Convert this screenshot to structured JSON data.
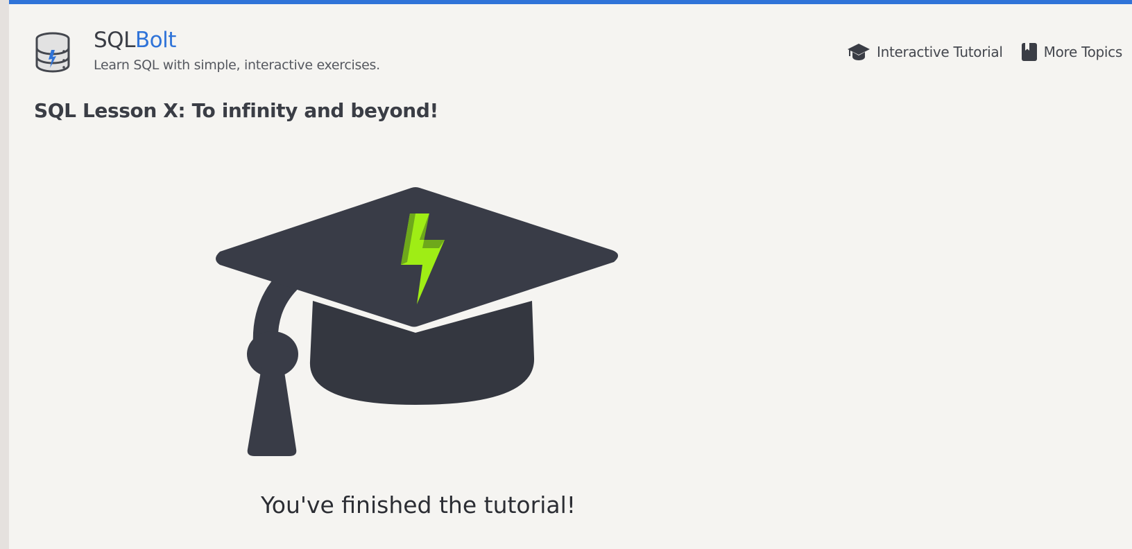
{
  "header": {
    "brand_prefix": "SQL",
    "brand_suffix": "Bolt",
    "tagline": "Learn SQL with simple, interactive exercises.",
    "logo_icon": "database-bolt-icon"
  },
  "nav": {
    "items": [
      {
        "label": "Interactive Tutorial",
        "icon": "graduation-cap-icon"
      },
      {
        "label": "More Topics",
        "icon": "book-icon"
      }
    ]
  },
  "lesson": {
    "title": "SQL Lesson X: To infinity and beyond!",
    "illustration": "graduation-cap-bolt-icon",
    "message": "You've finished the tutorial!"
  },
  "colors": {
    "accent": "#2f73d8",
    "cap": "#393c47",
    "bolt": "#8fdc12",
    "background": "#f5f4f1"
  }
}
